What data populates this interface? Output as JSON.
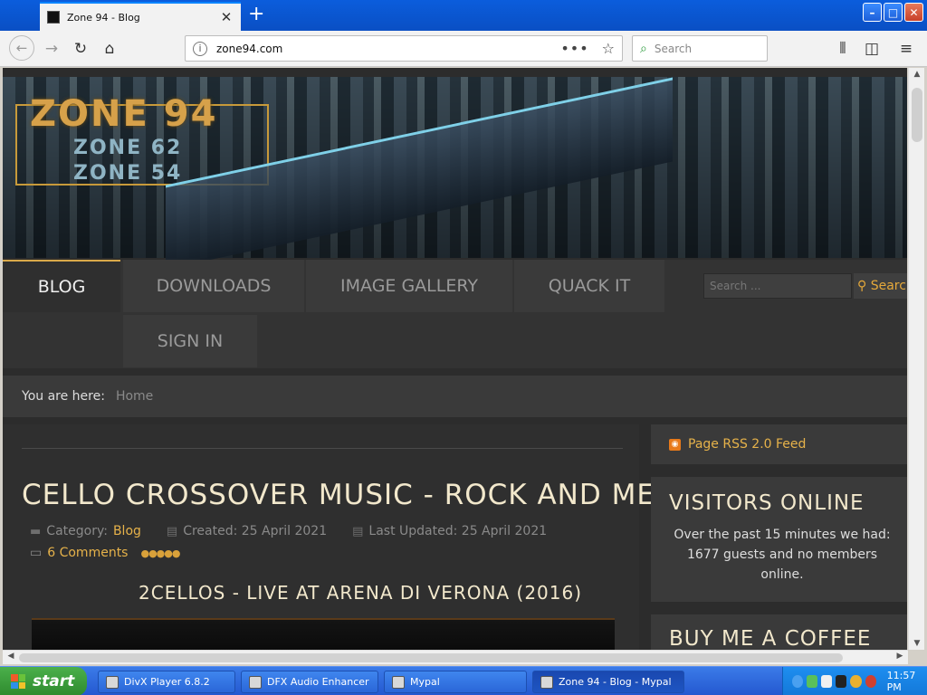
{
  "browser": {
    "tab_title": "Zone 94 - Blog",
    "tab_close": "✕",
    "new_tab": "+",
    "url": "zone94.com",
    "url_actions": "•••",
    "search_placeholder": "Search",
    "window_buttons": {
      "minimize": "–",
      "maximize": "□",
      "close": "✕"
    }
  },
  "site": {
    "logo_main": "ZONE 94",
    "logo_sub_1": "ZONE 62",
    "logo_sub_2": "ZONE 54",
    "nav": [
      {
        "label": "BLOG",
        "active": true
      },
      {
        "label": "DOWNLOADS",
        "active": false
      },
      {
        "label": "IMAGE GALLERY",
        "active": false
      },
      {
        "label": "QUACK IT",
        "active": false
      },
      {
        "label": "SIGN IN",
        "active": false
      }
    ],
    "nav_search_placeholder": "Search ...",
    "nav_search_button": "Search",
    "breadcrumb": {
      "label": "You are here:",
      "home": "Home"
    },
    "article": {
      "title": "CELLO CROSSOVER MUSIC - ROCK AND METAL",
      "category_label": "Category:",
      "category": "Blog",
      "created": "Created: 25 April 2021",
      "updated": "Last Updated: 25 April 2021",
      "comments": "6 Comments",
      "rating": "●●●●●",
      "subtitle": "2CELLOS - LIVE AT ARENA DI VERONA (2016)"
    },
    "sidebar": {
      "rss": "Page RSS 2.0 Feed",
      "visitors_title": "VISITORS ONLINE",
      "visitors_text": "Over the past 15 minutes we had: 1677 guests and no members online.",
      "coffee_title": "BUY ME A COFFEE"
    }
  },
  "taskbar": {
    "start": "start",
    "tasks": [
      {
        "label": "DivX Player 6.8.2"
      },
      {
        "label": "DFX Audio Enhancer"
      },
      {
        "label": "Mypal"
      },
      {
        "label": "Zone 94 - Blog - Mypal"
      }
    ],
    "clock": "11:57 PM"
  }
}
